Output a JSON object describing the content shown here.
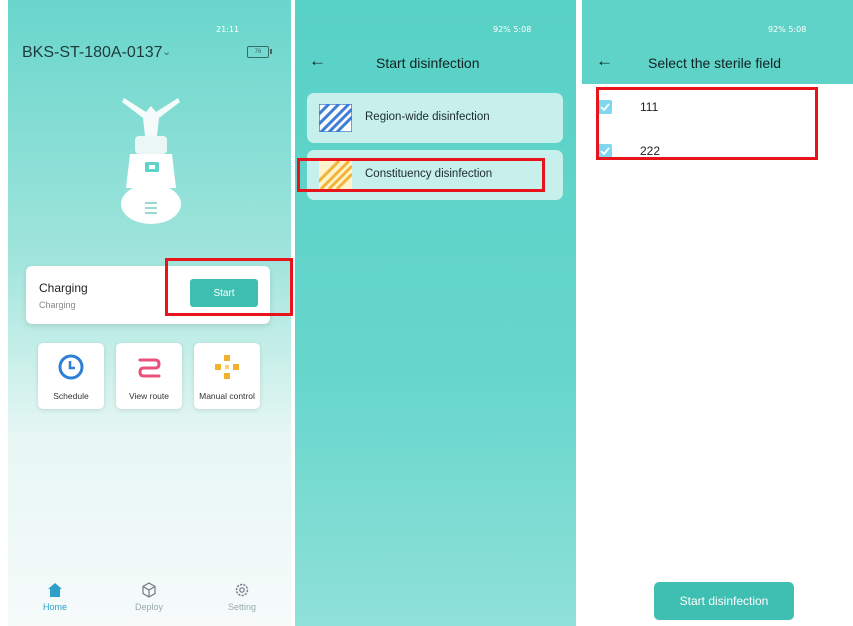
{
  "colors": {
    "teal": "#5fd3c8",
    "button_teal": "#3fbfb2",
    "highlight_red": "#e8141c",
    "checkbox_blue": "#7fd7f0"
  },
  "screen_home": {
    "status_bar": "21:11",
    "device_name": "BKS-ST-180A-0137",
    "battery_label": "76",
    "status_card": {
      "title": "Charging",
      "subtitle": "Charging",
      "start_label": "Start"
    },
    "tiles": [
      {
        "label": "Schedule",
        "icon": "clock-icon"
      },
      {
        "label": "View route",
        "icon": "route-icon"
      },
      {
        "label": "Manual control",
        "icon": "dpad-icon"
      }
    ],
    "nav": [
      {
        "label": "Home",
        "icon": "home-icon",
        "active": true
      },
      {
        "label": "Deploy",
        "icon": "cube-icon",
        "active": false
      },
      {
        "label": "Setting",
        "icon": "gear-icon",
        "active": false
      }
    ]
  },
  "screen_disinfection": {
    "status_bar": "92% 5:08",
    "title": "Start disinfection",
    "options": [
      {
        "label": "Region-wide disinfection",
        "icon": "striped-blue-icon"
      },
      {
        "label": "Constituency disinfection",
        "icon": "striped-yellow-icon"
      }
    ]
  },
  "screen_field": {
    "status_bar": "92% 5:08",
    "title": "Select the sterile field",
    "fields": [
      {
        "label": "111",
        "checked": true
      },
      {
        "label": "222",
        "checked": true
      }
    ],
    "start_button_label": "Start disinfection"
  }
}
